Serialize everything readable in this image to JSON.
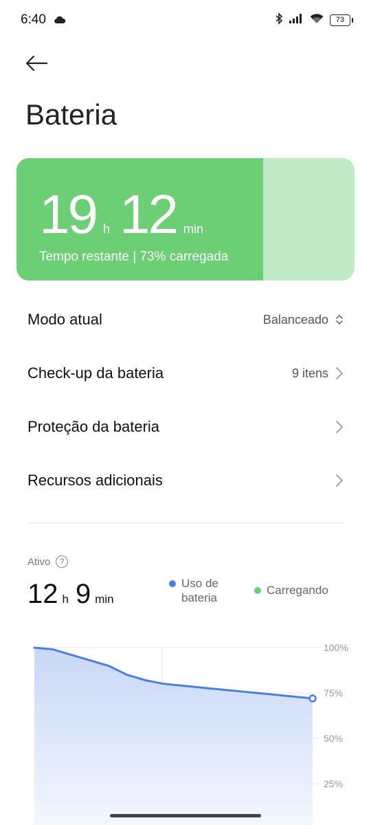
{
  "status_bar": {
    "time": "6:40",
    "battery_level": "73",
    "icons": [
      "cloud-icon",
      "bluetooth-icon",
      "signal-icon",
      "wifi-icon",
      "battery-icon"
    ]
  },
  "header": {
    "back_icon": "arrow-left-icon",
    "title": "Bateria"
  },
  "battery_card": {
    "hours": "19",
    "hours_unit": "h",
    "minutes": "12",
    "minutes_unit": "min",
    "subtitle": "Tempo restante | 73% carregada",
    "charge_fraction": 0.73,
    "fill_color": "#6ccf75",
    "track_color": "#c0ebc6"
  },
  "settings": {
    "mode": {
      "label": "Modo atual",
      "value": "Balanceado",
      "icon": "unfold-icon"
    },
    "checkup": {
      "label": "Check-up da bateria",
      "value": "9 itens",
      "icon": "chevron-right-icon"
    },
    "protection": {
      "label": "Proteção da bateria",
      "icon": "chevron-right-icon"
    },
    "extra": {
      "label": "Recursos adicionais",
      "icon": "chevron-right-icon"
    }
  },
  "usage": {
    "active_label": "Ativo",
    "help_icon": "help-icon",
    "hours": "12",
    "hours_unit": "h",
    "minutes": "9",
    "minutes_unit": "min",
    "legend": [
      {
        "label_line1": "Uso de",
        "label_line2": "bateria",
        "color": "#4a7fe0"
      },
      {
        "label_line1": "Carregando",
        "label_line2": "",
        "color": "#6ccf75"
      }
    ]
  },
  "chart_data": {
    "type": "area",
    "y_ticks": [
      "100%",
      "75%",
      "50%",
      "25%"
    ],
    "ylim": [
      0,
      100
    ],
    "x": [
      0,
      1,
      2,
      3,
      4,
      5,
      6,
      7,
      8,
      9,
      10,
      11,
      12
    ],
    "series": [
      {
        "values": [
          100,
          99,
          96,
          93,
          90,
          85,
          82,
          80,
          79,
          78,
          77,
          76,
          75,
          74,
          73,
          72
        ]
      }
    ],
    "line_color": "#4a7fe0",
    "fill_color": "#dfe8fb"
  }
}
